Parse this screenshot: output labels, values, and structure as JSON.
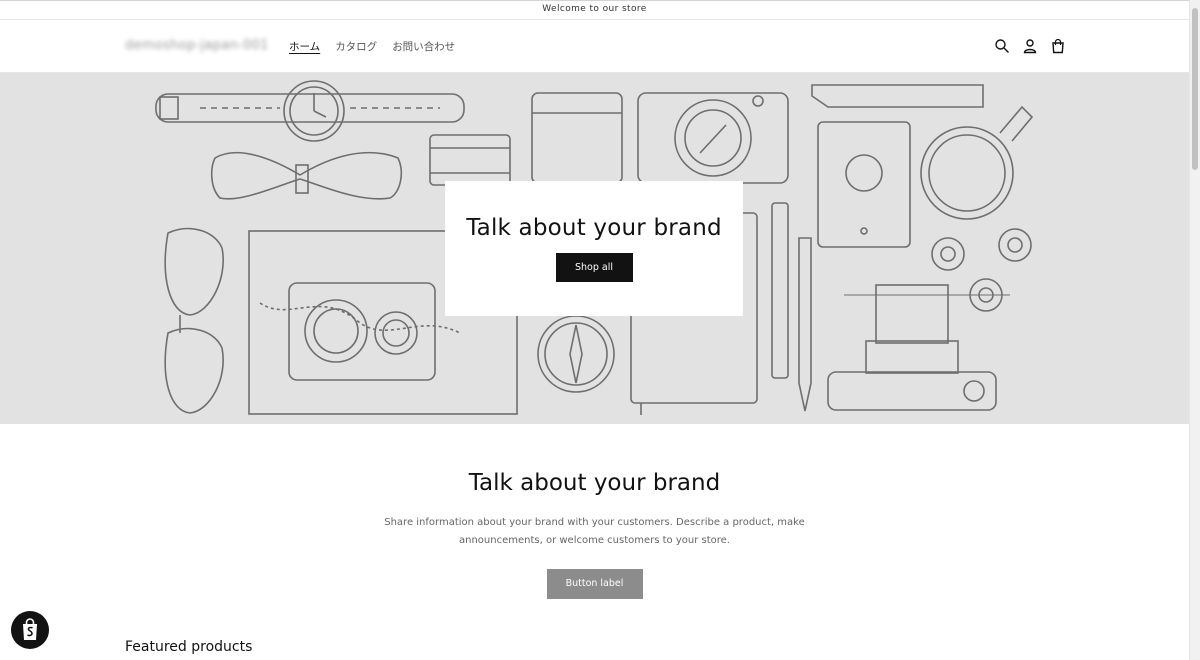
{
  "announcement": "Welcome to our store",
  "header": {
    "logo": "demoshop-japan-001",
    "nav": [
      "ホーム",
      "カタログ",
      "お問い合わせ"
    ],
    "active_nav": "ホーム",
    "icons": [
      "search-icon",
      "account-icon",
      "cart-icon"
    ]
  },
  "hero": {
    "title": "Talk about your brand",
    "button": "Shop all",
    "background_color": "#e2e2e2"
  },
  "brand": {
    "title": "Talk about your brand",
    "text": "Share information about your brand with your customers. Describe a product, make announcements, or welcome customers to your store.",
    "button": "Button label"
  },
  "featured": {
    "title": "Featured products"
  },
  "badge": {
    "icon": "shopify-bag-icon"
  },
  "colors": {
    "primary_button": "#121212",
    "secondary_button": "#8c8c8c",
    "text": "#121212",
    "muted_text": "#666666"
  }
}
